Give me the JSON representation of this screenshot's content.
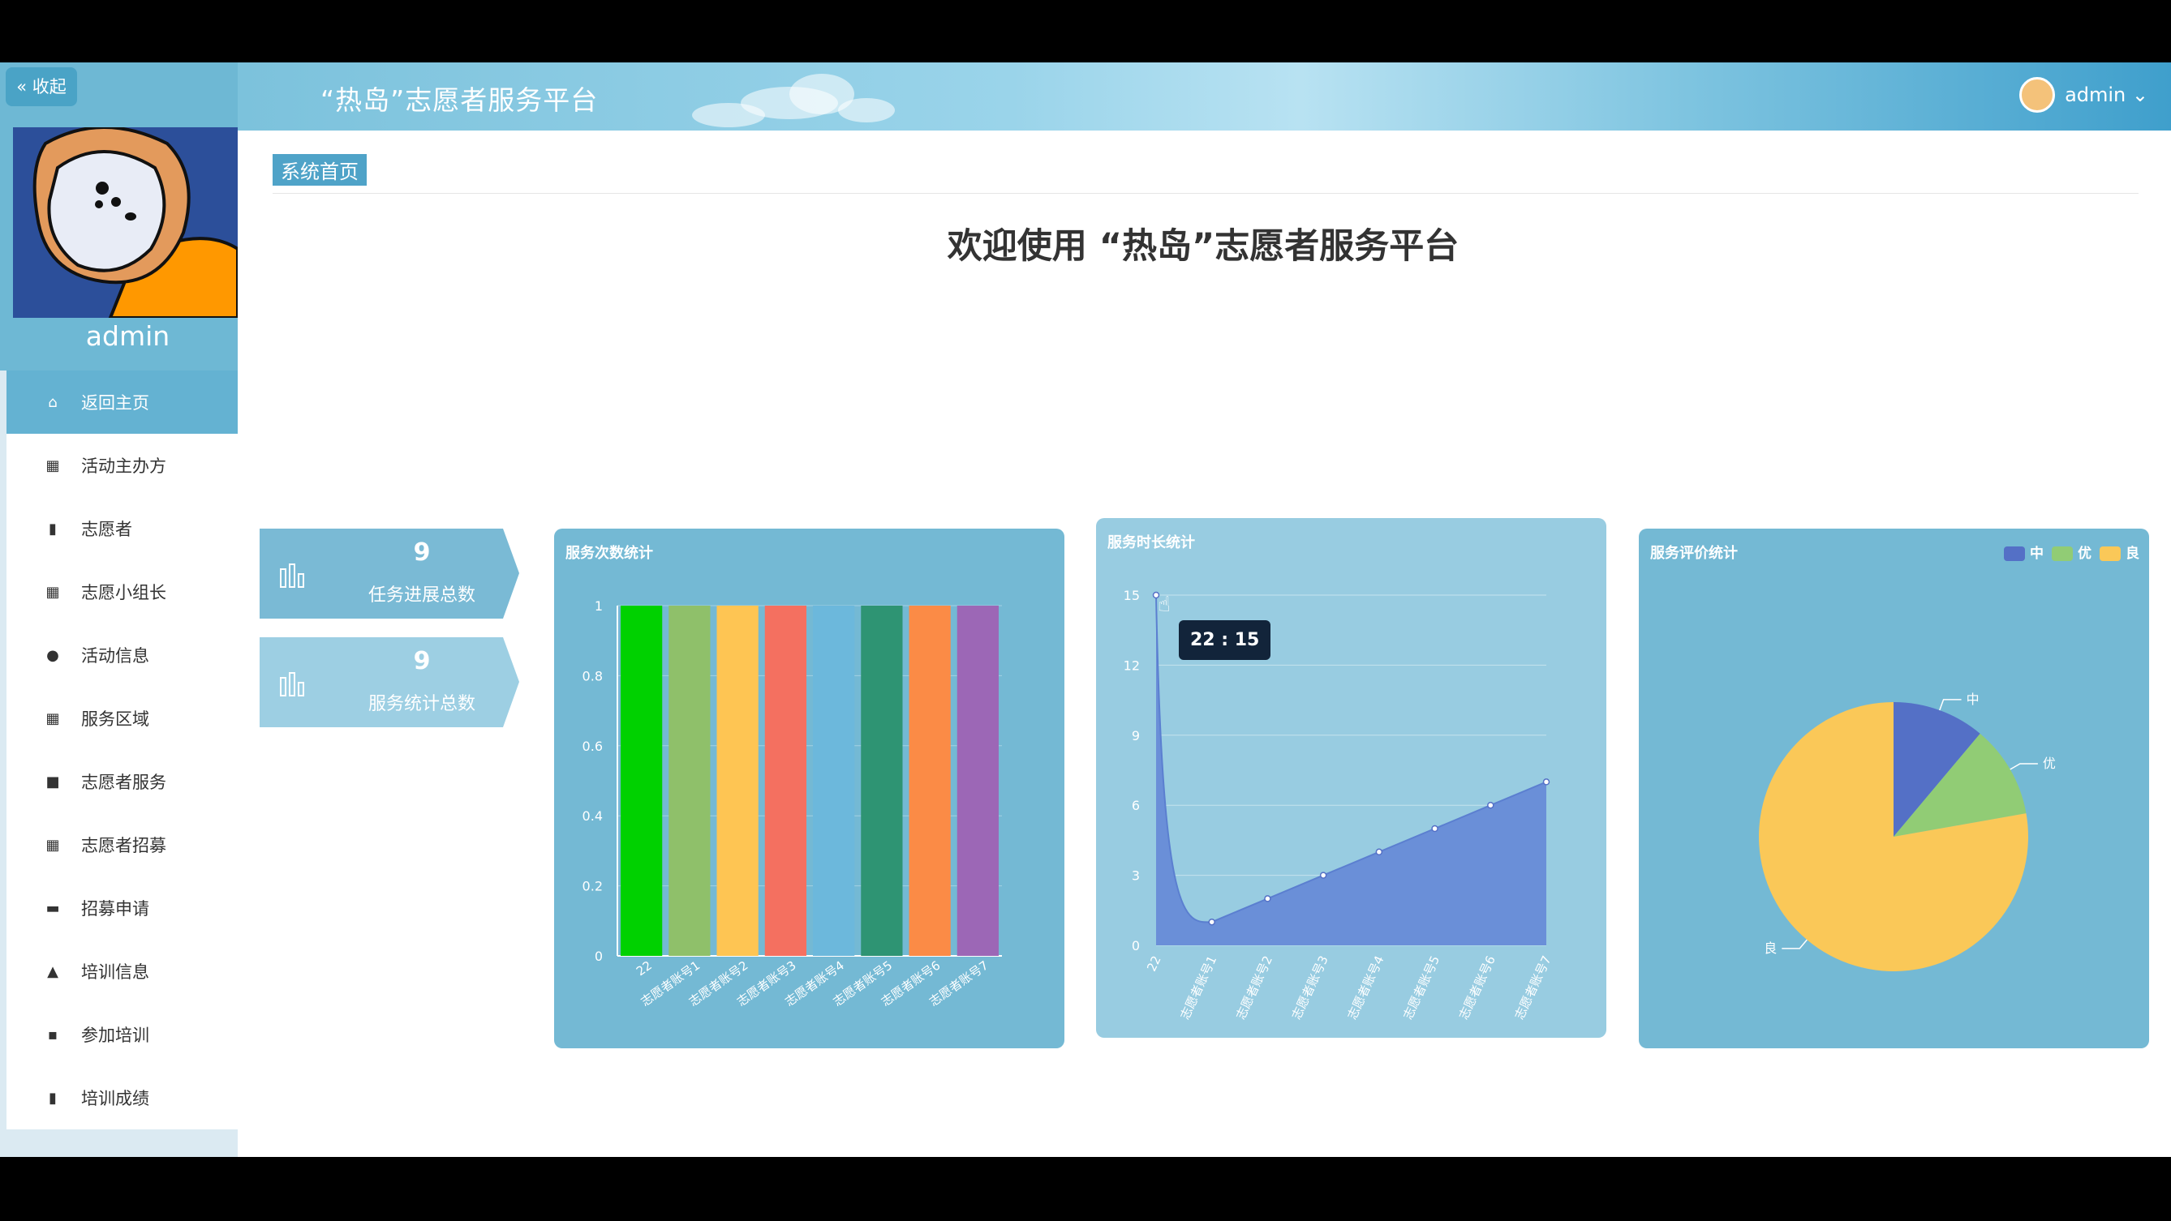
{
  "sidebar": {
    "collapse_label": "« 收起",
    "admin_name": "admin",
    "items": [
      {
        "label": "返回主页",
        "icon": "home-icon",
        "glyph": "⌂"
      },
      {
        "label": "活动主办方",
        "icon": "grid-icon",
        "glyph": "▦"
      },
      {
        "label": "志愿者",
        "icon": "books-icon",
        "glyph": "▮"
      },
      {
        "label": "志愿小组长",
        "icon": "grid-icon",
        "glyph": "▦"
      },
      {
        "label": "活动信息",
        "icon": "map-pin-icon",
        "glyph": "●"
      },
      {
        "label": "服务区域",
        "icon": "grid-icon",
        "glyph": "▦"
      },
      {
        "label": "志愿者服务",
        "icon": "video-icon",
        "glyph": "■"
      },
      {
        "label": "志愿者招募",
        "icon": "grid-icon",
        "glyph": "▦"
      },
      {
        "label": "招募申请",
        "icon": "briefcase-icon",
        "glyph": "▬"
      },
      {
        "label": "培训信息",
        "icon": "user-icon",
        "glyph": "▲"
      },
      {
        "label": "参加培训",
        "icon": "comment-icon",
        "glyph": "▪"
      },
      {
        "label": "培训成绩",
        "icon": "clipboard-icon",
        "glyph": "▮"
      }
    ]
  },
  "header": {
    "title": "“热岛”志愿者服务平台",
    "user": "admin ⌄"
  },
  "content": {
    "breadcrumb": "系统首页",
    "welcome": "欢迎使用 “热岛”志愿者服务平台",
    "stats": [
      {
        "value": "9",
        "label": "任务进展总数"
      },
      {
        "value": "9",
        "label": "服务统计总数"
      }
    ],
    "tooltip": "22 : 15"
  },
  "colors": {
    "bar_card": "#74b9d4",
    "line_card": "#98cce1",
    "pie_card": "#74b9d4",
    "active_menu": "#64b2d2",
    "line_area": "#6a8fd8"
  },
  "chart_data": [
    {
      "type": "bar",
      "title": "服务次数统计",
      "categories": [
        "22",
        "志愿者账号1",
        "志愿者账号2",
        "志愿者账号3",
        "志愿者账号4",
        "志愿者账号5",
        "志愿者账号6",
        "志愿者账号7"
      ],
      "values": [
        1,
        1,
        1,
        1,
        1,
        1,
        1,
        1
      ],
      "bar_colors": [
        "#00d100",
        "#8fc06a",
        "#fec553",
        "#f47060",
        "#6cb8dc",
        "#2e9473",
        "#fb8b46",
        "#9c67b6"
      ],
      "ylim": [
        0,
        1
      ],
      "yticks": [
        "0",
        "0.2",
        "0.4",
        "0.6",
        "0.8",
        "1"
      ],
      "grid": true
    },
    {
      "type": "area",
      "title": "服务时长统计",
      "categories": [
        "22",
        "志愿者账号1",
        "志愿者账号2",
        "志愿者账号3",
        "志愿者账号4",
        "志愿者账号5",
        "志愿者账号6",
        "志愿者账号7"
      ],
      "values": [
        15,
        1,
        2,
        3,
        4,
        5,
        6,
        7
      ],
      "ylim": [
        0,
        15
      ],
      "yticks": [
        "0",
        "3",
        "6",
        "9",
        "12",
        "15"
      ],
      "grid": true
    },
    {
      "type": "pie",
      "title": "服务评价统计",
      "legend": [
        "中",
        "优",
        "良"
      ],
      "legend_position": "top-right",
      "slices": [
        {
          "name": "中",
          "value": 1,
          "color": "#5470c6"
        },
        {
          "name": "优",
          "value": 1,
          "color": "#91cc75"
        },
        {
          "name": "良",
          "value": 7,
          "color": "#fac858"
        }
      ]
    }
  ]
}
